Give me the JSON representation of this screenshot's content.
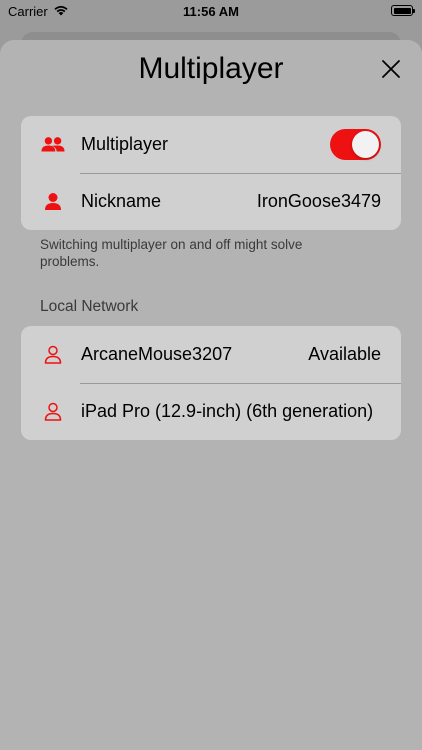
{
  "status_bar": {
    "carrier": "Carrier",
    "time": "11:56 AM",
    "wifi_icon": "wifi-icon",
    "battery_level": 1.0
  },
  "sheet": {
    "title": "Multiplayer",
    "close_icon": "close-icon"
  },
  "settings_group": {
    "multiplayer": {
      "label": "Multiplayer",
      "icon": "people-icon",
      "toggle_on": true,
      "toggle_color": "#ee1111"
    },
    "nickname": {
      "label": "Nickname",
      "icon": "person-fill-icon",
      "value": "IronGoose3479"
    }
  },
  "footer_note": "Switching multiplayer on and off might solve problems.",
  "local_network": {
    "header": "Local Network",
    "devices": [
      {
        "name": "ArcaneMouse3207",
        "status": "Available",
        "icon": "person-outline-icon"
      },
      {
        "name": "iPad Pro (12.9-inch) (6th generation)",
        "status": "",
        "icon": "person-outline-icon"
      }
    ]
  },
  "accent_color": "#ee1111"
}
